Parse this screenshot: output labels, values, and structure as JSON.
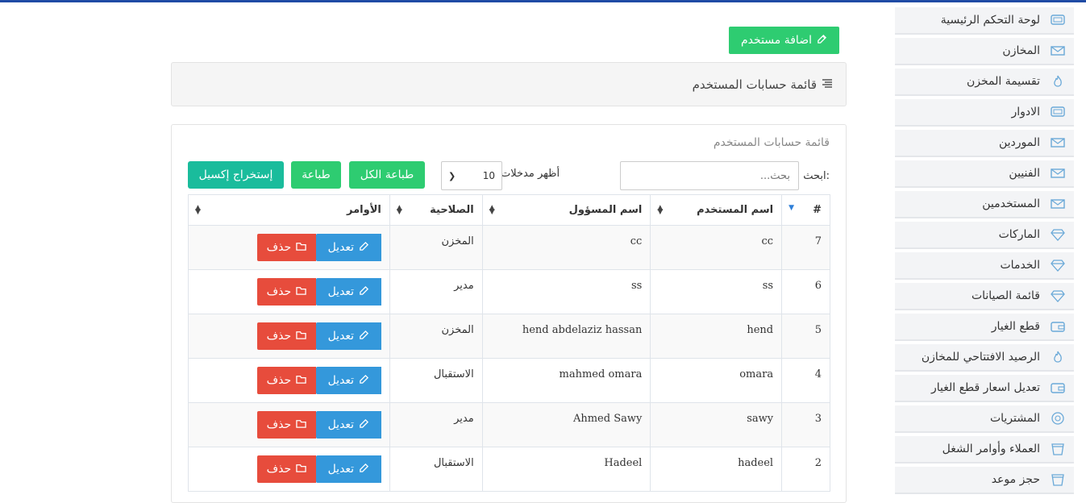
{
  "sidebar": {
    "items": [
      {
        "label": "لوحة التحكم الرئيسية",
        "icon": "monitor-icon"
      },
      {
        "label": "المخازن",
        "icon": "envelope-icon"
      },
      {
        "label": "تقسيمة المخزن",
        "icon": "flame-icon"
      },
      {
        "label": "الادوار",
        "icon": "monitor-icon"
      },
      {
        "label": "الموردين",
        "icon": "envelope-icon"
      },
      {
        "label": "الفنيين",
        "icon": "envelope-icon"
      },
      {
        "label": "المستخدمين",
        "icon": "envelope-icon"
      },
      {
        "label": "الماركات",
        "icon": "diamond-icon"
      },
      {
        "label": "الخدمات",
        "icon": "diamond-icon"
      },
      {
        "label": "قائمة الصيانات",
        "icon": "diamond-icon"
      },
      {
        "label": "قطع الغيار",
        "icon": "wallet-icon"
      },
      {
        "label": "الرصيد الافتتاحي للمخازن",
        "icon": "flame-icon"
      },
      {
        "label": "تعديل اسعار قطع الغيار",
        "icon": "wallet-icon"
      },
      {
        "label": "المشتريات",
        "icon": "disc-icon"
      },
      {
        "label": "العملاء وأوامر الشغل",
        "icon": "cup-icon"
      },
      {
        "label": "حجز موعد",
        "icon": "cup-icon"
      }
    ]
  },
  "toolbar": {
    "add_user_label": "اضافة مستخدم"
  },
  "panel": {
    "title": "قائمة حسابات المستخدم"
  },
  "card": {
    "title": "قائمة حسابات المستخدم"
  },
  "filters": {
    "search_label": "ابحث:",
    "search_placeholder": "بحث...",
    "length_label": "أظهر مدخلات",
    "length_value": "10"
  },
  "buttons": {
    "print_all": "طباعة الكل",
    "print": "طباعة",
    "excel": "إستخراج إكسيل"
  },
  "table": {
    "headers": [
      "#",
      "اسم المستخدم",
      "اسم المسؤول",
      "الصلاحية",
      "الأوامر"
    ],
    "edit_label": "تعديل",
    "delete_label": "حذف",
    "rows": [
      {
        "id": "7",
        "username": "cc",
        "name": "cc",
        "role": "المخزن"
      },
      {
        "id": "6",
        "username": "ss",
        "name": "ss",
        "role": "مدير"
      },
      {
        "id": "5",
        "username": "hend",
        "name": "hend abdelaziz hassan",
        "role": "المخزن"
      },
      {
        "id": "4",
        "username": "omara",
        "name": "mahmed omara",
        "role": "الاستقبال"
      },
      {
        "id": "3",
        "username": "sawy",
        "name": "Ahmed Sawy",
        "role": "مدير"
      },
      {
        "id": "2",
        "username": "hadeel",
        "name": "Hadeel",
        "role": "الاستقبال"
      }
    ]
  },
  "colors": {
    "accent": "#2ecc71",
    "edit": "#3498db",
    "delete": "#e74c3c",
    "excel": "#1abc9c",
    "topbar": "#1f4ba5"
  }
}
